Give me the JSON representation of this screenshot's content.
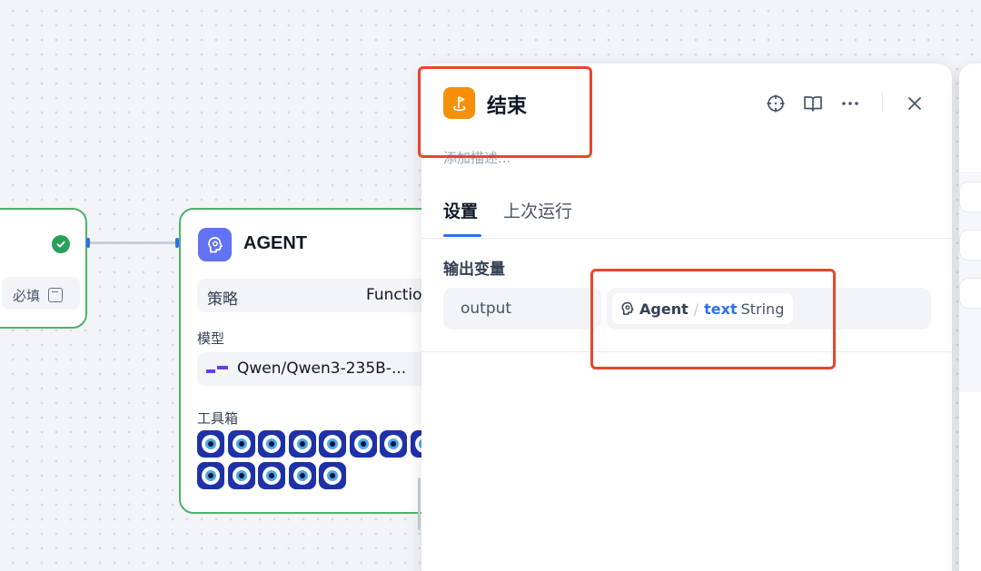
{
  "left_node": {
    "required_label": "必填"
  },
  "agent_node": {
    "title": "AGENT",
    "strategy_label": "策略",
    "strategy_value": "Function",
    "model_label": "模型",
    "model_value": "Qwen/Qwen3-235B-...",
    "toolbox_label": "工具箱",
    "tool_count": 13
  },
  "end_panel": {
    "title": "结束",
    "description_placeholder": "添加描述...",
    "tabs": [
      {
        "label": "设置",
        "active": true
      },
      {
        "label": "上次运行",
        "active": false
      }
    ],
    "section_title": "输出变量",
    "output_variable": {
      "name": "output",
      "source_node": "Agent",
      "separator": "/",
      "variable": "text",
      "type": "String"
    },
    "header_icons": [
      "crosshair-icon",
      "book-icon",
      "more-icon",
      "close-icon"
    ]
  },
  "colors": {
    "node_border": "#4fb26b",
    "end_icon_bg": "#f79009",
    "agent_icon_bg": "#6172f3",
    "accent_blue": "#2e6ff0",
    "annotation_red": "#e8462b"
  }
}
